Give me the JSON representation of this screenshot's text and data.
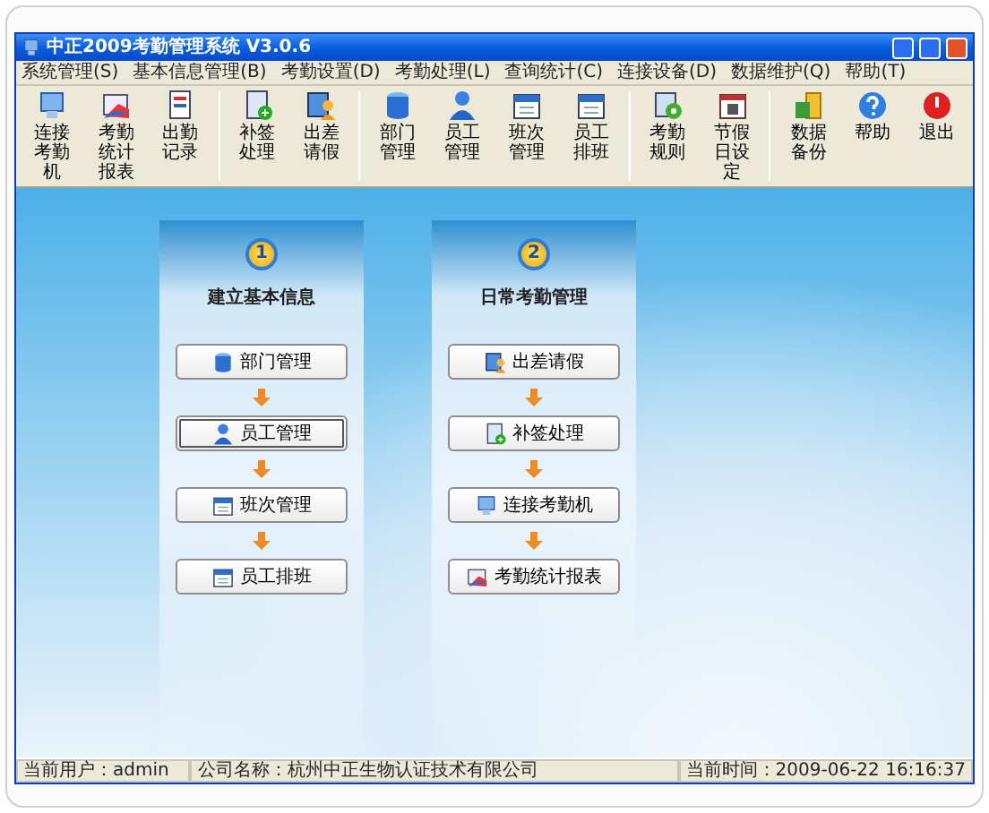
{
  "window": {
    "title": "中正2009考勤管理系统 V3.0.6"
  },
  "menu": [
    "系统管理(S)",
    "基本信息管理(B)",
    "考勤设置(D)",
    "考勤处理(L)",
    "查询统计(C)",
    "连接设备(D)",
    "数据维护(Q)",
    "帮助(T)"
  ],
  "toolbar": [
    [
      "连接考勤机",
      "考勤统计报表",
      "出勤记录"
    ],
    [
      "补签处理",
      "出差请假"
    ],
    [
      "部门管理",
      "员工管理",
      "班次管理",
      "员工排班"
    ],
    [
      "考勤规则",
      "节假日设定"
    ],
    [
      "数据备份",
      "帮助",
      "退出"
    ]
  ],
  "panels": [
    {
      "number": "1",
      "title": "建立基本信息",
      "buttons": [
        {
          "label": "部门管理",
          "focused": false
        },
        {
          "label": "员工管理",
          "focused": true
        },
        {
          "label": "班次管理",
          "focused": false
        },
        {
          "label": "员工排班",
          "focused": false
        }
      ]
    },
    {
      "number": "2",
      "title": "日常考勤管理",
      "buttons": [
        {
          "label": "出差请假",
          "focused": false
        },
        {
          "label": "补签处理",
          "focused": false
        },
        {
          "label": "连接考勤机",
          "focused": false
        },
        {
          "label": "考勤统计报表",
          "focused": false
        }
      ]
    }
  ],
  "status_bar": [
    "当前用户：admin",
    "公司名称：杭州中正生物认证技术有限公司",
    "当前时间：2009-06-22 16:16:37"
  ]
}
